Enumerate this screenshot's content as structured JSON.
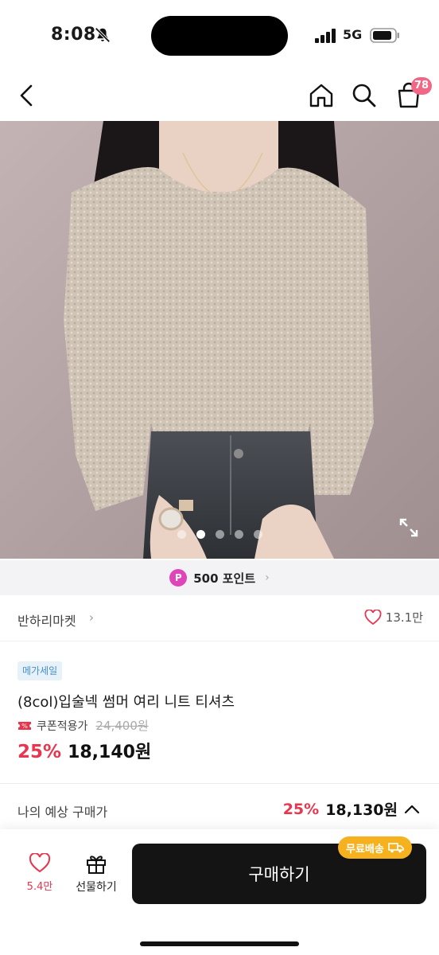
{
  "status_bar": {
    "time": "8:08",
    "network": "5G"
  },
  "nav": {
    "cart_count": "78"
  },
  "gallery": {
    "total": 5,
    "active_index": 1
  },
  "points": {
    "label": "500 포인트",
    "icon_letter": "P"
  },
  "seller": {
    "name": "반하리마켓",
    "like_count": "13.1만"
  },
  "product": {
    "badge": "메가세일",
    "title": "(8col)입술넥 썸머 여리 니트 티셔츠",
    "coupon_label": "쿠폰적용가",
    "original_price": "24,400원",
    "discount_rate": "25%",
    "price": "18,140원"
  },
  "estimate": {
    "label": "나의 예상 구매가",
    "discount_rate": "25%",
    "price": "18,130원"
  },
  "bottom_bar": {
    "wish_count": "5.4만",
    "gift_label": "선물하기",
    "buy_label": "구매하기",
    "free_shipping_label": "무료배송"
  },
  "colors": {
    "accent_red": "#e8364f",
    "badge_pink": "#f26785",
    "points_purple": "#e044b8",
    "shipping_yellow": "#f6b11f",
    "buy_button": "#141414"
  }
}
